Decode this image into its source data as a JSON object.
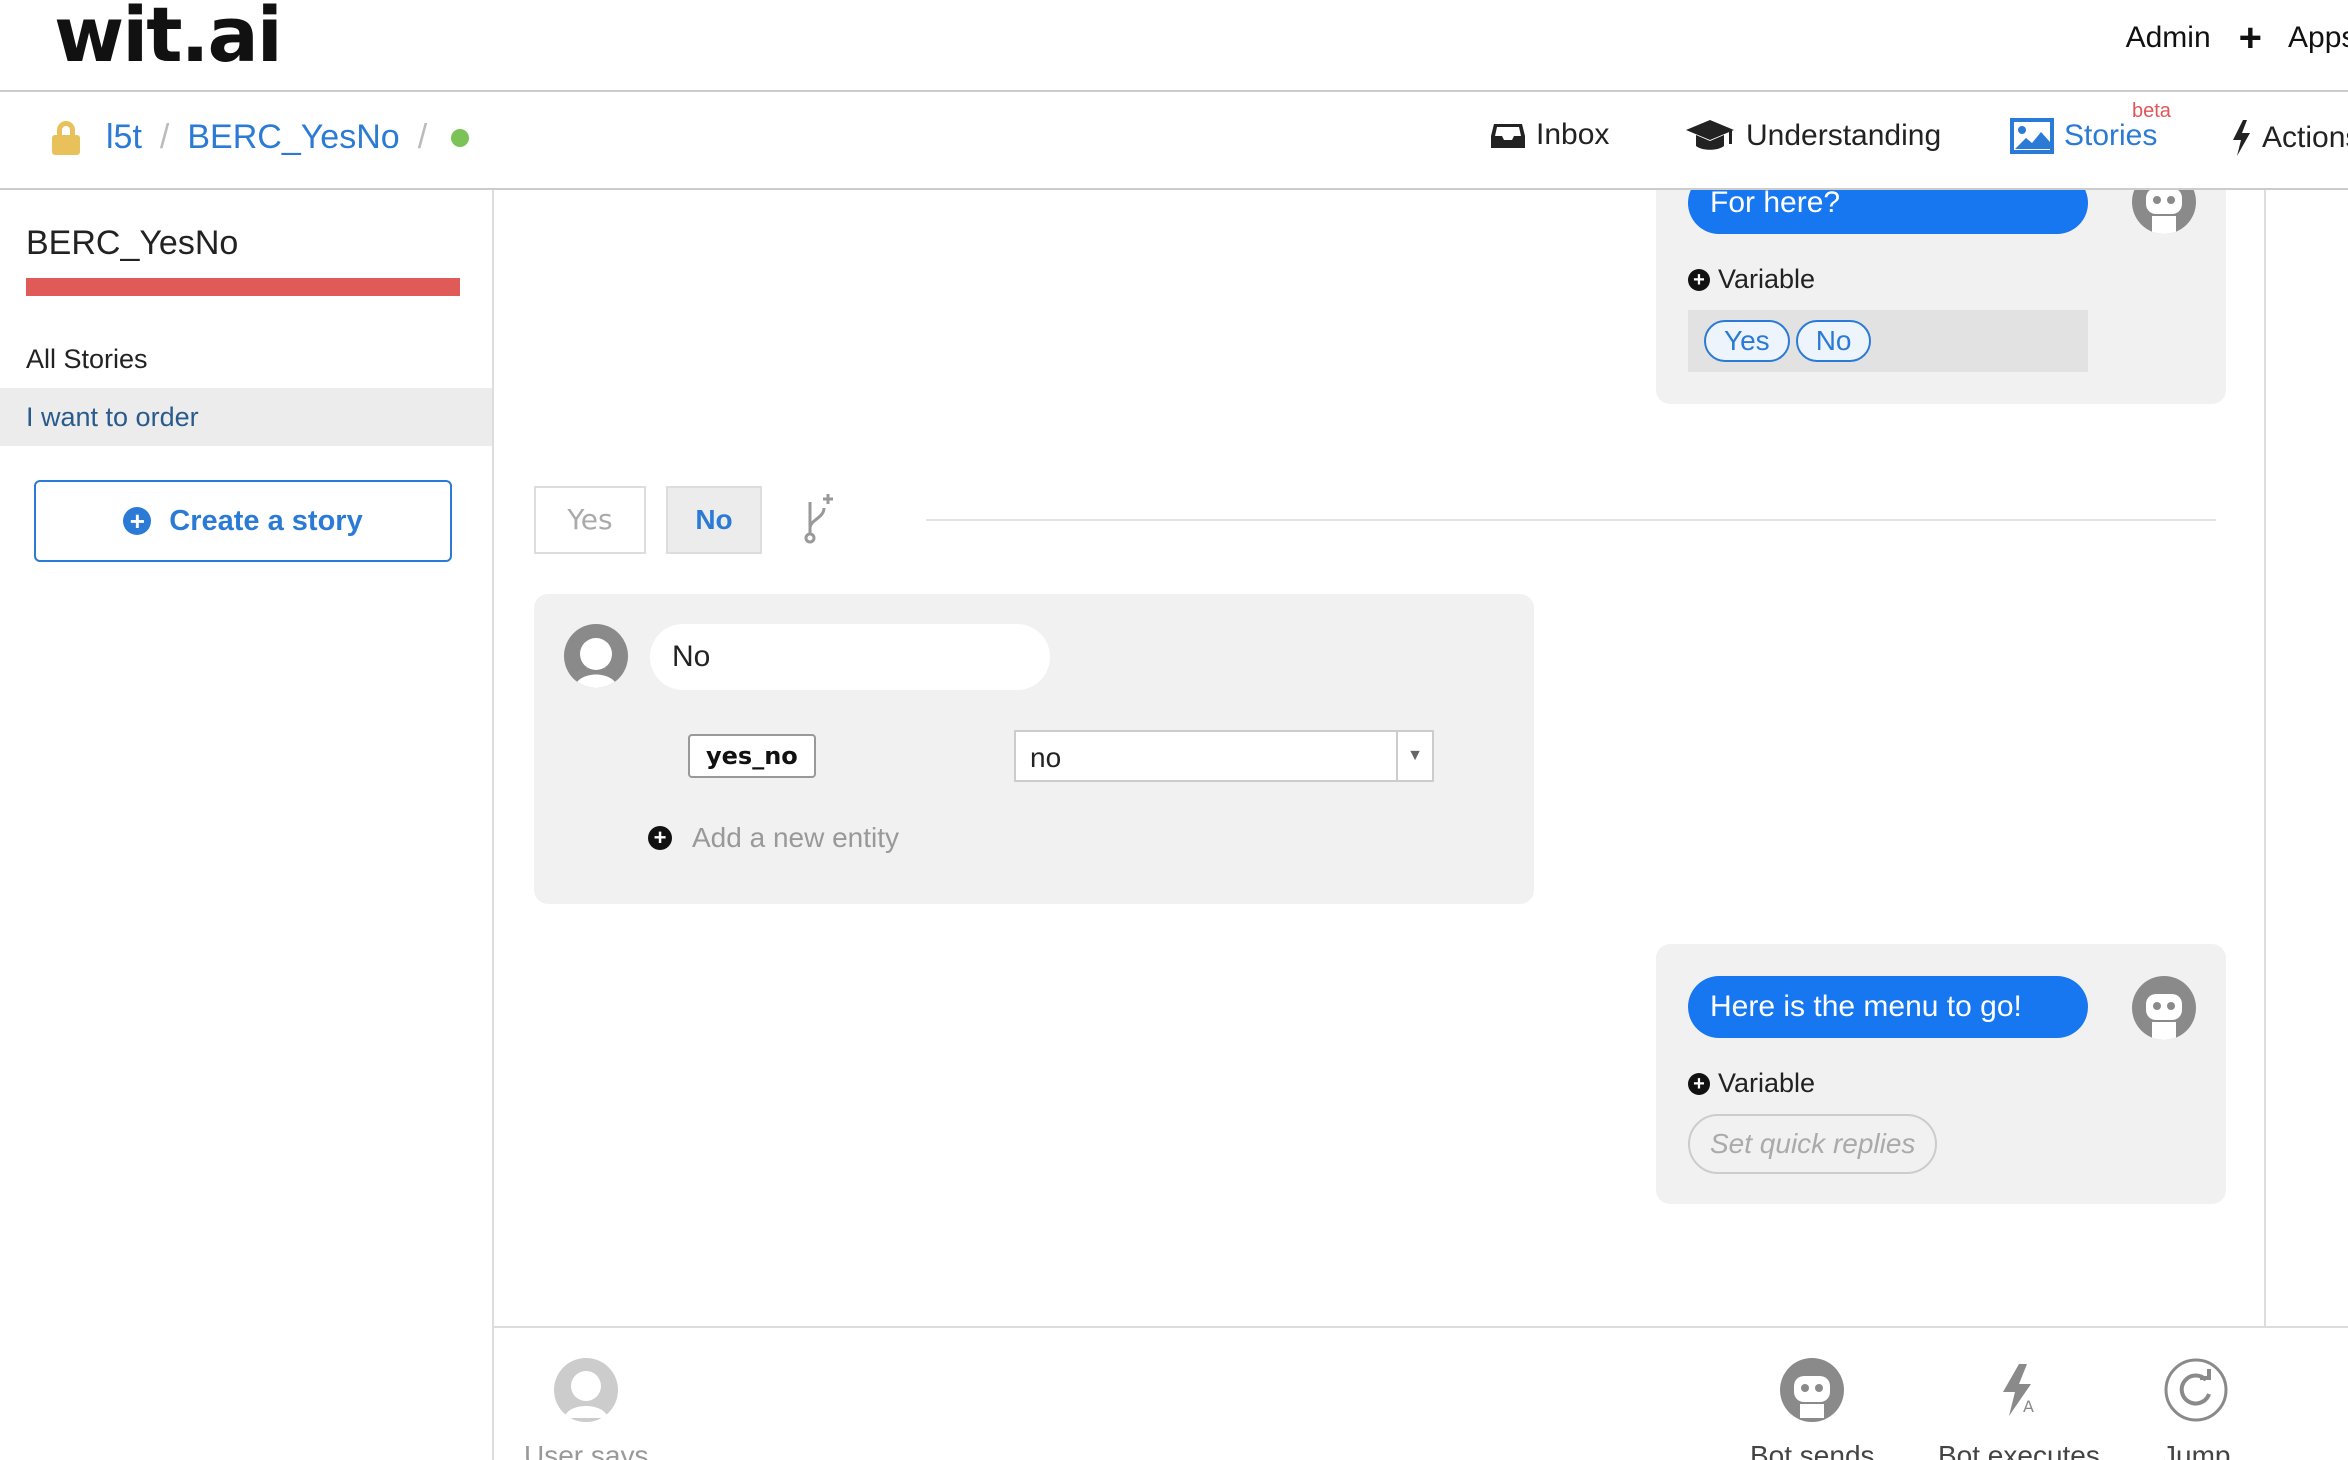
{
  "header": {
    "logo": "wit.ai",
    "admin_label": "Admin",
    "plus_label": "+",
    "app_label": "Apps"
  },
  "breadcrumb": {
    "user": "l5t",
    "separator": "/",
    "app": "BERC_YesNo",
    "status_color": "#7cc357"
  },
  "nav": {
    "inbox": "Inbox",
    "understanding": "Understanding",
    "stories": "Stories",
    "stories_badge": "beta",
    "actions": "Actions"
  },
  "sidebar": {
    "title": "BERC_YesNo",
    "section": "All Stories",
    "items": [
      {
        "label": "I want to order"
      }
    ],
    "create_button": "Create a story"
  },
  "story": {
    "bot_turn_1": {
      "message": "For here?",
      "variable_label": "Variable",
      "quick_replies": [
        "Yes",
        "No"
      ]
    },
    "branch_tabs": {
      "yes": "Yes",
      "no": "No",
      "selected": "No"
    },
    "user_turn": {
      "message": "No",
      "entity_name": "yes_no",
      "entity_value": "no",
      "add_entity_label": "Add a new entity"
    },
    "bot_turn_2": {
      "message": "Here is the menu to go!",
      "variable_label": "Variable",
      "quick_replies_placeholder": "Set quick replies"
    }
  },
  "toolbar": {
    "user_says": "User says",
    "bot_sends": "Bot sends",
    "bot_executes": "Bot executes",
    "jump": "Jump"
  },
  "colors": {
    "accent": "#2b7bd6",
    "bubble": "#1677f0",
    "sidebar_bar": "#e05a58",
    "beta": "#e0555a",
    "lock": "#e8c15a"
  },
  "icons": {
    "lock": "lock-icon",
    "inbox": "inbox-icon",
    "understanding": "graduation-cap-icon",
    "stories": "image-icon",
    "actions": "lightning-icon",
    "branch": "branch-add-icon",
    "user_avatar": "user-avatar-icon",
    "bot_avatar": "robot-icon",
    "jump": "redo-arrow-icon"
  }
}
